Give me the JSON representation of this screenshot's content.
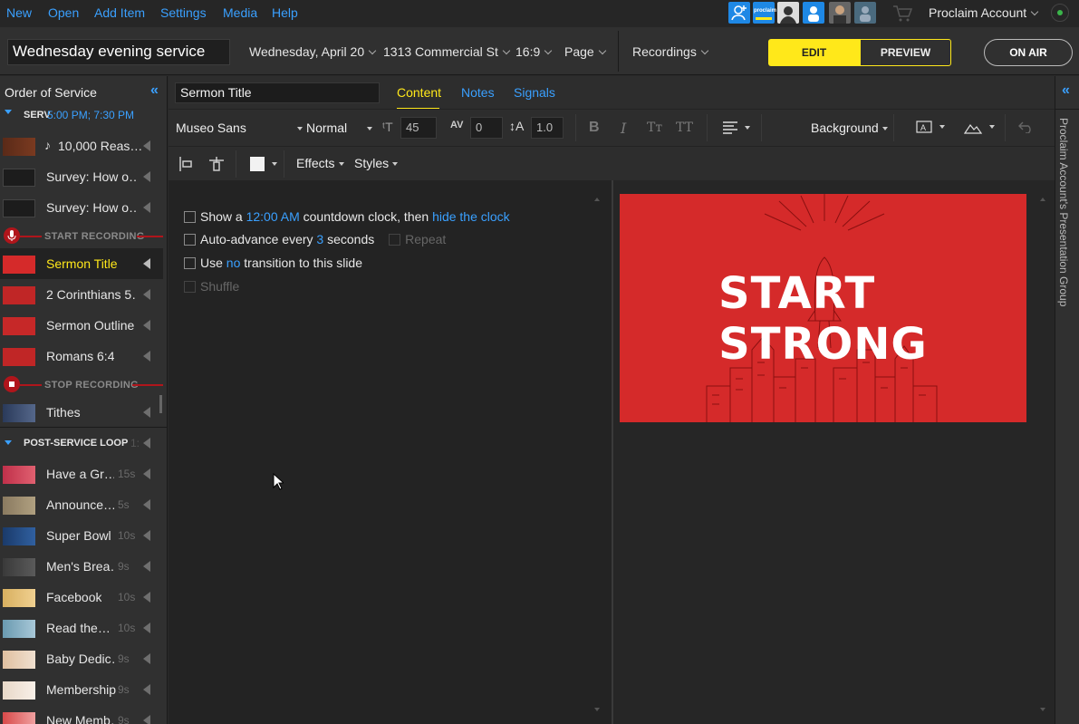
{
  "menu": [
    "New",
    "Open",
    "Add Item",
    "Settings",
    "Media",
    "Help"
  ],
  "account": {
    "name": "Proclaim Account",
    "badge": "proclaim"
  },
  "service": {
    "title": "Wednesday evening service",
    "date": "Wednesday, April 20",
    "location": "1313 Commercial St",
    "aspect": "16:9",
    "page": "Page",
    "recordings": "Recordings"
  },
  "mode": {
    "edit": "EDIT",
    "preview": "PREVIEW",
    "on_air": "ON AIR"
  },
  "sidebar": {
    "title": "Order of Service",
    "section1": {
      "label": "SERV",
      "times": "5:00 PM; 7:30 PM"
    },
    "items": [
      {
        "label": "10,000 Reas…",
        "music": "♪"
      },
      {
        "label": "Survey: How o…"
      },
      {
        "label": "Survey: How o…"
      }
    ],
    "start_recording": "START RECORDING",
    "selected": "Sermon Title",
    "items2": [
      {
        "label": "2 Corinthians 5…"
      },
      {
        "label": "Sermon Outline"
      },
      {
        "label": "Romans 6:4"
      }
    ],
    "stop_recording": "STOP RECORDING",
    "tithes": "Tithes",
    "section2": {
      "label": "POST-SERVICE LOOP",
      "dur": "1:"
    },
    "loop": [
      {
        "label": "Have a Gr…",
        "dur": "15s"
      },
      {
        "label": "Announce…",
        "dur": "5s"
      },
      {
        "label": "Super Bowl",
        "dur": "10s"
      },
      {
        "label": "Men's Brea…",
        "dur": "9s"
      },
      {
        "label": "Facebook",
        "dur": "10s"
      },
      {
        "label": "Read the…",
        "dur": "10s"
      },
      {
        "label": "Baby Dedic…",
        "dur": "9s"
      },
      {
        "label": "Membership",
        "dur": "9s"
      },
      {
        "label": "New Memb…",
        "dur": "9s"
      }
    ]
  },
  "editor": {
    "item_title": "Sermon Title",
    "tabs": [
      "Content",
      "Notes",
      "Signals"
    ],
    "font": "Museo Sans",
    "weight": "Normal",
    "size": "45",
    "spacing": "0",
    "line_height": "1.0",
    "background": "Background",
    "effects": "Effects",
    "styles": "Styles",
    "options": {
      "opt1_a": "Show a",
      "opt1_time": "12:00 AM",
      "opt1_b": "countdown clock, then",
      "opt1_link": "hide the clock",
      "opt2_a": "Auto-advance every",
      "opt2_n": "3",
      "opt2_b": "seconds",
      "repeat": "Repeat",
      "opt3_a": "Use",
      "opt3_link": "no",
      "opt3_b": "transition to this slide",
      "shuffle": "Shuffle"
    }
  },
  "slide": {
    "text_left": "START",
    "text_right": "STRONG"
  },
  "right_panel": {
    "label": "Proclaim Account's Presentation Group"
  },
  "colors": {
    "accent_blue": "#3aa0ff",
    "accent_yellow": "#ffe81a",
    "slide_red": "#d52a2a",
    "record_red": "#b0151b"
  }
}
